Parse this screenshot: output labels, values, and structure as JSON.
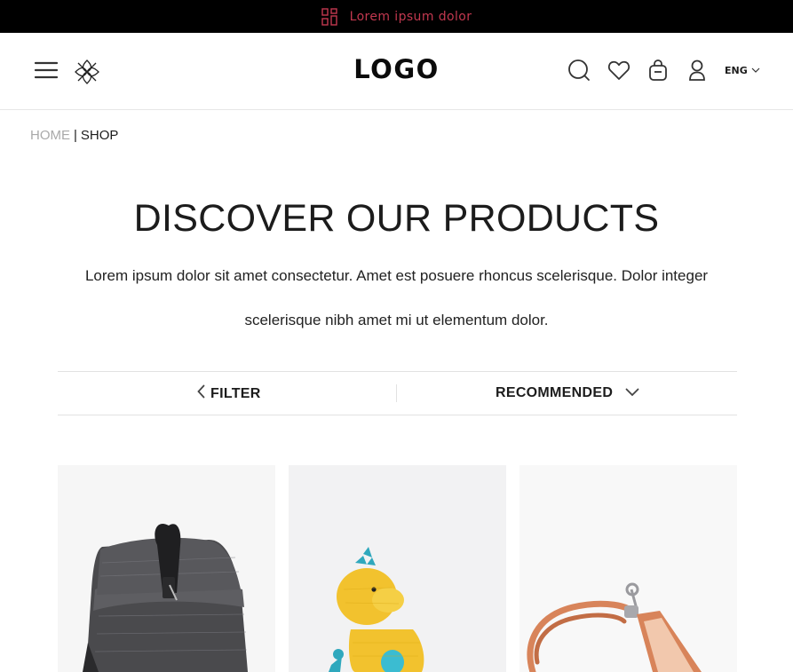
{
  "announcement": {
    "text": "Lorem ipsum dolor",
    "icon": "grid-icon",
    "color": "#c2384f"
  },
  "header": {
    "logo": "LOGO",
    "language": "ENG",
    "icons": [
      "menu-icon",
      "brand-mark-icon",
      "search-icon",
      "heart-icon",
      "bag-icon",
      "user-icon",
      "chevron-down-icon"
    ]
  },
  "breadcrumb": {
    "home": "HOME",
    "separator": "|",
    "current": "SHOP"
  },
  "main": {
    "title": "DISCOVER OUR PRODUCTS",
    "intro": "Lorem ipsum dolor sit amet consectetur. Amet est posuere rhoncus scelerisque. Dolor integer scelerisque nibh amet mi ut elementum dolor."
  },
  "toolbar": {
    "filter_label": "FILTER",
    "sort_label": "RECOMMENDED"
  },
  "products": [
    {
      "image": "grey-roll-top-backpack"
    },
    {
      "image": "yellow-crochet-dinosaur-toy"
    },
    {
      "image": "tan-leather-strap-card-holder"
    }
  ]
}
